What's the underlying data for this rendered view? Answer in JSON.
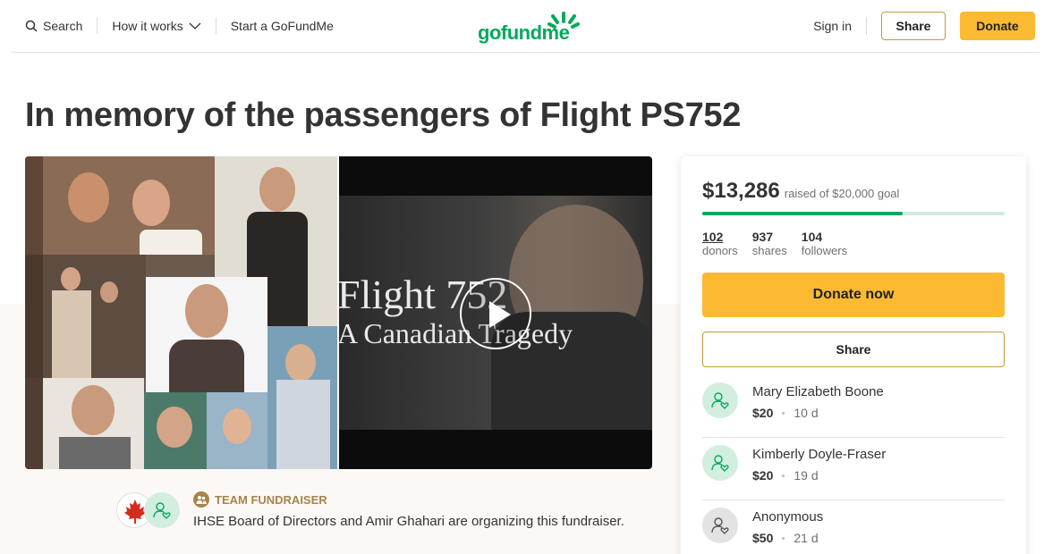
{
  "header": {
    "search_label": "Search",
    "how_it_works_label": "How it works",
    "start_label": "Start a GoFundMe",
    "logo_text": "gofundme",
    "signin_label": "Sign in",
    "share_label": "Share",
    "donate_label": "Donate"
  },
  "campaign": {
    "title": "In memory of the passengers of Flight PS752"
  },
  "video": {
    "title_line1": "Flight 752",
    "title_line2": "A Canadian Tragedy"
  },
  "organizer": {
    "label": "TEAM FUNDRAISER",
    "text": "IHSE Board of Directors and Amir Ghahari are organizing this fundraiser."
  },
  "sidebar": {
    "raised_amount": "$13,286",
    "raised_goal_text": "raised of $20,000 goal",
    "progress_fraction": 0.664,
    "stats": [
      {
        "value": "102",
        "label": "donors"
      },
      {
        "value": "937",
        "label": "shares"
      },
      {
        "value": "104",
        "label": "followers"
      }
    ],
    "donate_now_label": "Donate now",
    "share_label": "Share",
    "donations": [
      {
        "name": "Mary Elizabeth Boone",
        "amount": "$20",
        "time": "10 d"
      },
      {
        "name": "Kimberly Doyle-Fraser",
        "amount": "$20",
        "time": "19 d"
      },
      {
        "name": "Anonymous",
        "amount": "$50",
        "time": "21 d"
      }
    ]
  },
  "colors": {
    "brand_green": "#02a95c",
    "donate_yellow": "#fbba31",
    "share_border": "#c49a3a",
    "team_label": "#a6844b"
  }
}
